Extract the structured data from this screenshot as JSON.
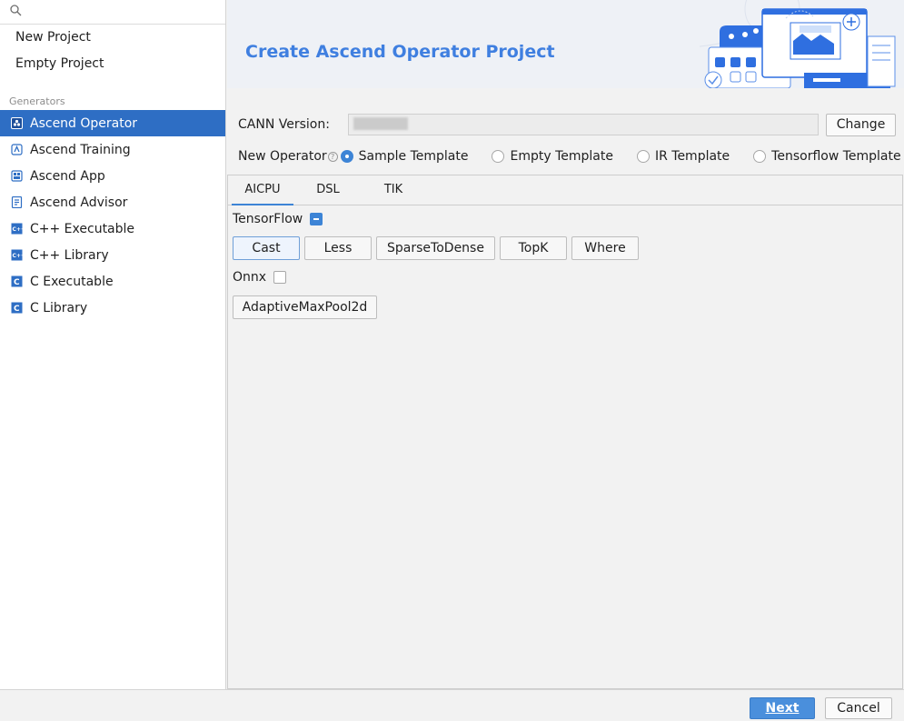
{
  "sidebar": {
    "search": {
      "value": "",
      "placeholder": ""
    },
    "top_items": [
      {
        "label": "New Project"
      },
      {
        "label": "Empty Project"
      }
    ],
    "generators_label": "Generators",
    "generators": [
      {
        "label": "Ascend Operator",
        "icon": "ascend-operator-icon",
        "selected": true
      },
      {
        "label": "Ascend Training",
        "icon": "ascend-training-icon"
      },
      {
        "label": "Ascend App",
        "icon": "ascend-app-icon"
      },
      {
        "label": "Ascend Advisor",
        "icon": "ascend-advisor-icon"
      },
      {
        "label": "C++ Executable",
        "icon": "cpp-executable-icon"
      },
      {
        "label": "C++ Library",
        "icon": "cpp-library-icon"
      },
      {
        "label": "C Executable",
        "icon": "c-executable-icon"
      },
      {
        "label": "C Library",
        "icon": "c-library-icon"
      }
    ]
  },
  "banner": {
    "title": "Create Ascend Operator Project"
  },
  "cann": {
    "label": "CANN Version:",
    "value": "",
    "change_label": "Change"
  },
  "operator": {
    "label": "New Operator",
    "templates": [
      {
        "label": "Sample Template",
        "checked": true
      },
      {
        "label": "Empty Template",
        "checked": false
      },
      {
        "label": "IR Template",
        "checked": false
      },
      {
        "label": "Tensorflow Template",
        "checked": false
      }
    ]
  },
  "tabs": [
    {
      "label": "AICPU",
      "active": true
    },
    {
      "label": "DSL"
    },
    {
      "label": "TIK"
    }
  ],
  "categories": [
    {
      "name": "TensorFlow",
      "state": "partial",
      "ops": [
        "Cast",
        "Less",
        "SparseToDense",
        "TopK",
        "Where"
      ],
      "selected_op": "Cast"
    },
    {
      "name": "Onnx",
      "state": "unchecked",
      "ops": [
        "AdaptiveMaxPool2d"
      ]
    }
  ],
  "footer": {
    "next_label": "Next",
    "cancel_label": "Cancel"
  },
  "colors": {
    "accent": "#2e6ec4",
    "title": "#3f7fe0",
    "primary_button": "#4a8fdc"
  }
}
